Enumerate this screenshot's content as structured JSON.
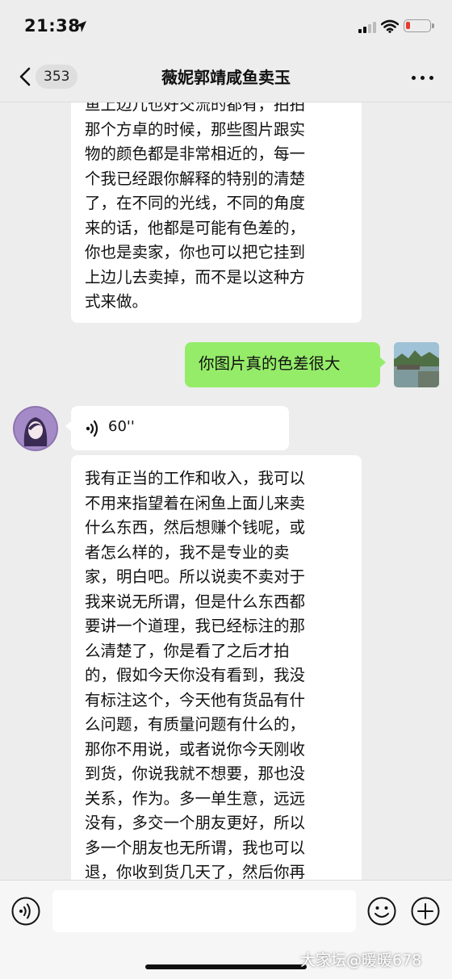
{
  "status_bar": {
    "time": "21:38"
  },
  "nav": {
    "unread_count": "353",
    "title": "薇妮郭靖咸鱼卖玉"
  },
  "messages": {
    "m1_text": "鱼上边儿也好交流的都有，拍拍\n那个方卓的时候，那些图片跟实\n物的颜色都是非常相近的，每一\n个我已经跟你解释的特别的清楚\n了，在不同的光线，不同的角度\n来的话，他都是可能有色差的，\n你也是卖家，你也可以把它挂到\n上边儿去卖掉，而不是以这种方\n式来做。",
    "m2_text": "你图片真的色差很大",
    "voice_duration": "60''",
    "m3_text": "我有正当的工作和收入，我可以\n不用来指望着在闲鱼上面儿来卖\n什么东西，然后想赚个钱呢，或\n者怎么样的，我不是专业的卖\n家，明白吧。所以说卖不卖对于\n我来说无所谓，但是什么东西都\n要讲一个道理，我已经标注的那\n么清楚了，你是看了之后才拍\n的，假如今天你没有看到，我没\n有标注这个，今天他有货品有什\n么问题，有质量问题有什么的，\n那你不用说，或者说你今天刚收\n到货，你说我就不想要，那也没\n关系，作为。多一单生意，远远\n没有，多交一个朋友更好，所以\n多一个朋友也无所谓，我也可以\n退，你收到货几天了，然后你再\n这样说，然后搞的莫实就气坏啦"
  },
  "input": {
    "value": ""
  },
  "watermark": "大家坛@暖暖678",
  "colors": {
    "background": "#ededed",
    "self_bubble": "#95ec69",
    "other_bubble": "#ffffff",
    "battery_low": "#e63b2e"
  },
  "icons": {
    "back": "chevron-left-icon",
    "more": "more-dots-icon",
    "voice_toggle": "voice-icon",
    "emoji": "emoji-icon",
    "plus": "plus-icon"
  }
}
